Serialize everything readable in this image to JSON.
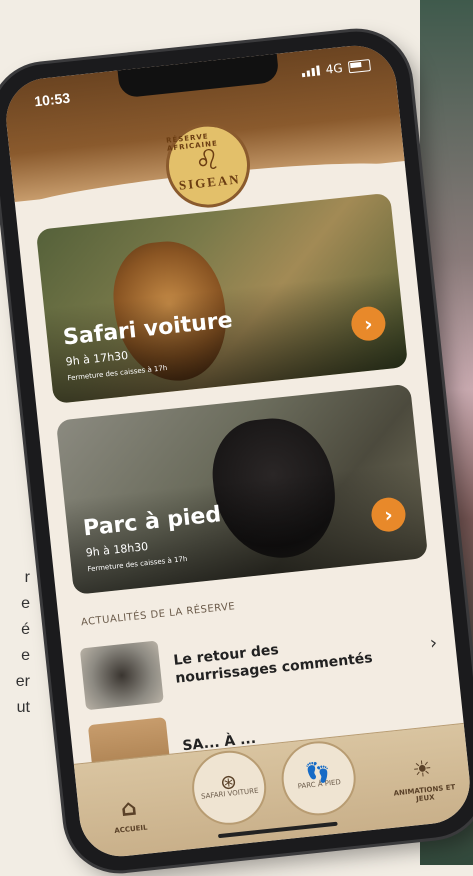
{
  "status_bar": {
    "time": "10:53",
    "network": "4G"
  },
  "logo": {
    "ring_text": "RÉSERVE AFRICAINE",
    "name": "SIGEAN"
  },
  "cards": [
    {
      "title": "Safari voiture",
      "hours": "9h à 17h30",
      "note": "Fermeture des caisses à 17h",
      "arrow": "›"
    },
    {
      "title": "Parc à pied",
      "hours": "9h à 18h30",
      "note": "Fermeture des caisses à 17h",
      "arrow": "›"
    }
  ],
  "news": {
    "heading": "ACTUALITÉS DE LA RÉSERVE",
    "items": [
      {
        "title": "Le retour des nourrissages commentés",
        "chevron": "›"
      },
      {
        "title": "SA... À ..."
      }
    ]
  },
  "tabbar": {
    "home": "ACCUEIL",
    "safari": "SAFARI VOITURE",
    "parc": "PARC À PIED",
    "animations": "ANIMATIONS ET JEUX"
  },
  "background_text": [
    "r",
    "e",
    "é",
    "e",
    "er",
    "ut"
  ]
}
